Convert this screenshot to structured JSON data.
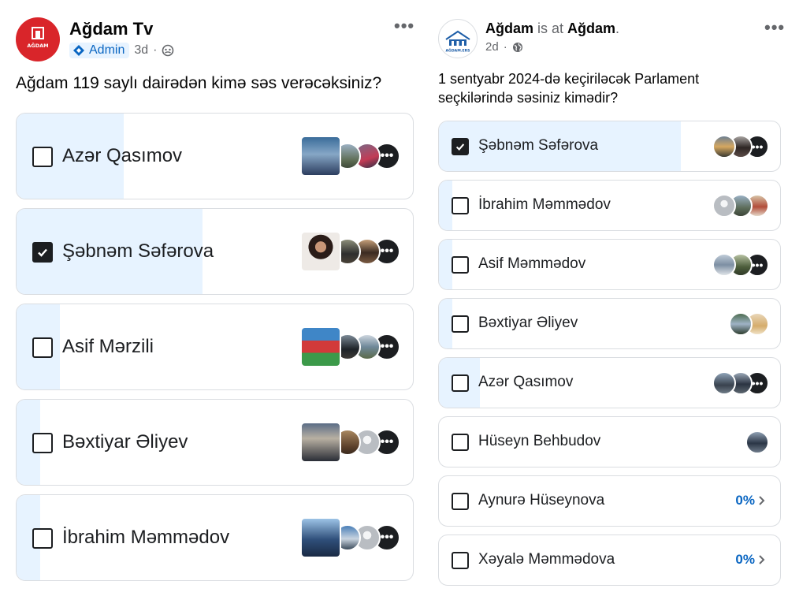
{
  "left_post": {
    "page_name": "Ağdam Tv",
    "avatar_text": "AĞDAM",
    "badge": "Admin",
    "time": "3d",
    "visibility_icon": "globe-icon",
    "more": "•••",
    "question": "Ağdam 119 saylı dairədən kimə səs verəcəksiniz?",
    "options": [
      {
        "label": "Azər Qasımov",
        "checked": false,
        "fill_fraction": 0.27
      },
      {
        "label": "Şəbnəm Səfərova",
        "checked": true,
        "fill_fraction": 0.47
      },
      {
        "label": "Asif Mərzili",
        "checked": false,
        "fill_fraction": 0.11
      },
      {
        "label": "Bəxtiyar Əliyev",
        "checked": false,
        "fill_fraction": 0.06
      },
      {
        "label": "İbrahim Məmmədov",
        "checked": false,
        "fill_fraction": 0.06
      }
    ],
    "more_voters_glyph": "•••"
  },
  "right_post": {
    "page_name": "Ağdam",
    "is_at_text": " is at ",
    "location": "Ağdam",
    "period": ".",
    "avatar_text": "AĞDAM.ERS",
    "time": "2d",
    "visibility_icon": "globe-icon",
    "more": "•••",
    "question_line1": "1 sentyabr 2024-də keçiriləcək Parlament",
    "question_line2": "seçkilərində səsiniz kimədir?",
    "options": [
      {
        "label": "Şəbnəm Səfərova",
        "checked": true,
        "fill_fraction": 0.71
      },
      {
        "label": "İbrahim Məmmədov",
        "checked": false,
        "fill_fraction": 0.04
      },
      {
        "label": "Asif Məmmədov",
        "checked": false,
        "fill_fraction": 0.04
      },
      {
        "label": "Bəxtiyar Əliyev",
        "checked": false,
        "fill_fraction": 0.04
      },
      {
        "label": "Azər Qasımov",
        "checked": false,
        "fill_fraction": 0.12
      },
      {
        "label": "Hüseyn Behbudov",
        "checked": false,
        "fill_fraction": 0.0
      },
      {
        "label": "Aynurə Hüseynova",
        "checked": false,
        "fill_fraction": 0.0,
        "percent": "0%"
      },
      {
        "label": "Xəyalə Məmmədova",
        "checked": false,
        "fill_fraction": 0.0,
        "percent": "0%"
      }
    ],
    "more_voters_glyph": "•••"
  },
  "colors": {
    "accent": "#0a66c2",
    "fill": "#e7f3ff",
    "border": "#dadde1",
    "brand_red": "#d9252a"
  }
}
